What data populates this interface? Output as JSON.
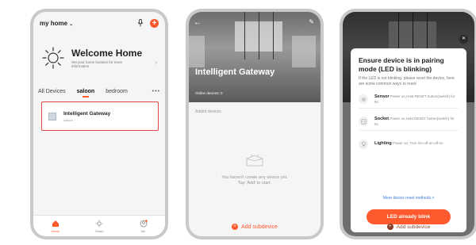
{
  "home": {
    "title": "my home",
    "welcome_title": "Welcome Home",
    "welcome_sub": "Set your home location for more information",
    "tabs": [
      "All Devices",
      "saloon",
      "bedroom"
    ],
    "more": "•••",
    "device_name": "Intelligent Gateway",
    "device_room": "saloon",
    "nav": [
      "Home",
      "Smart",
      "Me"
    ]
  },
  "gateway": {
    "title": "Intelligent Gateway",
    "online": "Online devices: 0",
    "added_label": "Added devices",
    "empty_line1": "You haven't create any device yet.",
    "empty_line2": "Tap 'Add' to start.",
    "add_subdevice": "Add subdevice"
  },
  "pairing": {
    "title": "Ensure device is in pairing mode (LED is blinking)",
    "desc": "If the LED is not blinking, please reset the device, here are some common ways to reset:",
    "items": [
      {
        "name": "Sensor",
        "desc": "Power on,Hold RESET button(switch) for 5s"
      },
      {
        "name": "Socket",
        "desc": "Power on,Hold RESET button(switch) for 5s"
      },
      {
        "name": "Lighting",
        "desc": "Power on, Turn On-off-on-off-on"
      }
    ],
    "more_link": "More device reset methods >",
    "button": "LED already blink",
    "add_subdevice": "Add subdevice"
  },
  "colors": {
    "accent": "#ff5a2e",
    "highlight_border": "#e64545",
    "link": "#3a7bd5"
  }
}
